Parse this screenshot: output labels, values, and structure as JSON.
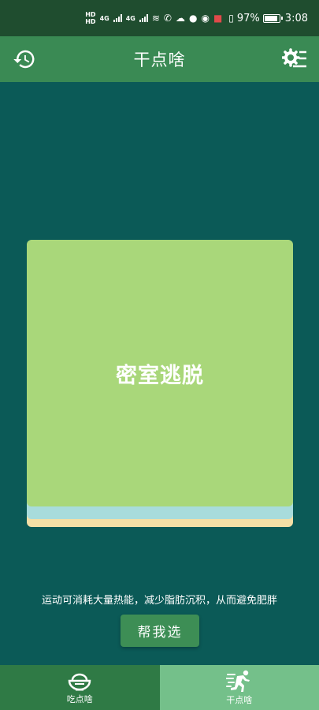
{
  "status_bar": {
    "signal1": "HD",
    "signal2": "HD",
    "net1": "4G",
    "net2": "4G",
    "battery": "97%",
    "time": "3:08"
  },
  "header": {
    "title": "干点啥",
    "left_icon": "history-icon",
    "right_icon": "settings-icon"
  },
  "card": {
    "activity": "密室逃脱",
    "colors": {
      "front": "#a9d77a",
      "back1": "#a8dcdc",
      "back2": "#f4dfa6"
    }
  },
  "tip": "运动可消耗大量热能，减少脂肪沉积，从而避免肥胖",
  "pick_button": "帮我选",
  "bottom_nav": {
    "items": [
      {
        "label": "吃点啥",
        "icon": "rice-bowl-icon",
        "active": false
      },
      {
        "label": "干点啥",
        "icon": "running-icon",
        "active": true
      }
    ]
  },
  "colors": {
    "background": "#0b5a57",
    "app_bar": "#3a8a54",
    "nav_active": "#74c08a",
    "nav_inactive": "#2f7a45"
  }
}
